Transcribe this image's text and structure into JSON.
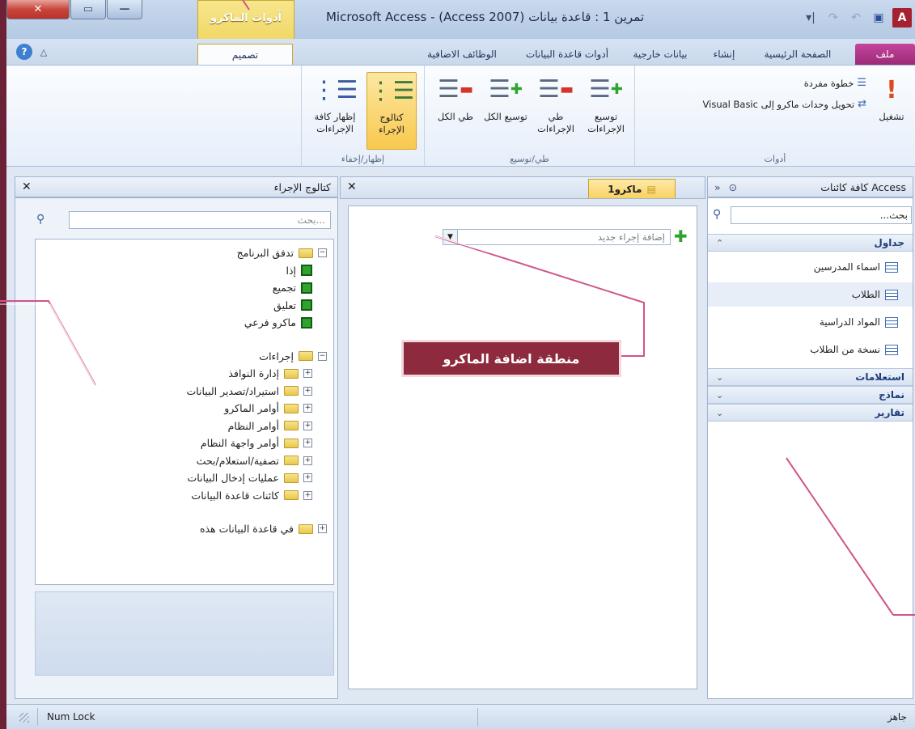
{
  "window": {
    "title": "Microsoft Access - (Access 2007) تمرين 1 : قاعدة بيانات",
    "contextual_tab": "أدوات الماكرو"
  },
  "tabs": [
    "ملف",
    "الصفحة الرئيسية",
    "إنشاء",
    "بيانات خارجية",
    "أدوات قاعدة البيانات",
    "الوظائف الاضافية",
    "تصميم"
  ],
  "ribbon": {
    "tools": {
      "label": "أدوات",
      "run": "تشغيل",
      "single_step": "خطوة مفردة",
      "convert": "تحويل وحدات ماكرو إلى Visual Basic"
    },
    "collapse_expand": {
      "label": "طي/توسيع",
      "expand_actions": "توسيع الإجراءات",
      "collapse_actions": "طي الإجراءات",
      "expand_all": "توسيع الكل",
      "collapse_all": "طي الكل"
    },
    "show_hide": {
      "label": "إظهار/إخفاء",
      "action_catalog": "كتالوج الإجراء",
      "show_all_actions": "إظهار كافة الإجراءات"
    }
  },
  "catalog": {
    "title": "كتالوج الإجراء",
    "search_placeholder": "بحث...",
    "program_flow": {
      "label": "تدفق البرنامج",
      "items": [
        "إذا",
        "تجميع",
        "تعليق",
        "ماكرو فرعي"
      ]
    },
    "actions": {
      "label": "إجراءات",
      "items": [
        "إدارة النوافذ",
        "استيراد/تصدير البيانات",
        "أوامر الماكرو",
        "أوامر النظام",
        "أوامر واجهة النظام",
        "تصفية/استعلام/بحث",
        "عمليات إدخال البيانات",
        "كائنات قاعدة البيانات"
      ]
    },
    "in_database": "في قاعدة البيانات هذه"
  },
  "macro": {
    "tab_label": "ماكرو1",
    "add_action_placeholder": "إضافة إجراء جديد",
    "annotation": "منطقة اضافة الماكرو"
  },
  "nav": {
    "title": "كافة كائنات Access",
    "search_placeholder": "بحث...",
    "groups": {
      "tables": {
        "label": "جداول",
        "items": [
          "اسماء المدرسين",
          "الطلاب",
          "المواد الدراسية",
          "نسخة من الطلاب"
        ]
      },
      "queries": "استعلامات",
      "forms": "نماذج",
      "reports": "تقارير"
    }
  },
  "status": {
    "ready": "جاهز",
    "num_lock": "Num Lock"
  },
  "colors": {
    "annotation_bg": "#8d2a3d",
    "active_button": "#f8c94e",
    "file_tab": "#b0368a"
  }
}
